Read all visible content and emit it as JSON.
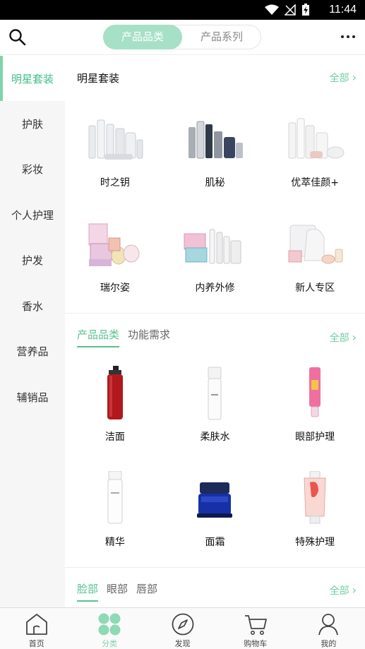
{
  "status": {
    "time": "11:44"
  },
  "header": {
    "tabs": [
      "产品品类",
      "产品系列"
    ]
  },
  "sidebar": {
    "items": [
      "明星套装",
      "护肤",
      "彩妆",
      "个人护理",
      "护发",
      "香水",
      "营养品",
      "辅销品"
    ]
  },
  "section1": {
    "title": "明星套装",
    "all": "全部",
    "items": [
      "时之钥",
      "肌秘",
      "优萃佳颜+",
      "瑞尔姿",
      "内养外修",
      "新人专区"
    ]
  },
  "section2": {
    "tabs": [
      "产品品类",
      "功能需求"
    ],
    "all": "全部",
    "items": [
      "洁面",
      "柔肤水",
      "眼部护理",
      "精华",
      "面霜",
      "特殊护理"
    ]
  },
  "section3": {
    "tabs": [
      "脸部",
      "眼部",
      "唇部"
    ],
    "all": "全部"
  },
  "bottom_nav": [
    "首页",
    "分类",
    "发现",
    "购物车",
    "我的"
  ],
  "colors": {
    "accent": "#7fd4ac",
    "accent_text": "#55c391",
    "sidebar_bg": "#f5f6f5"
  }
}
